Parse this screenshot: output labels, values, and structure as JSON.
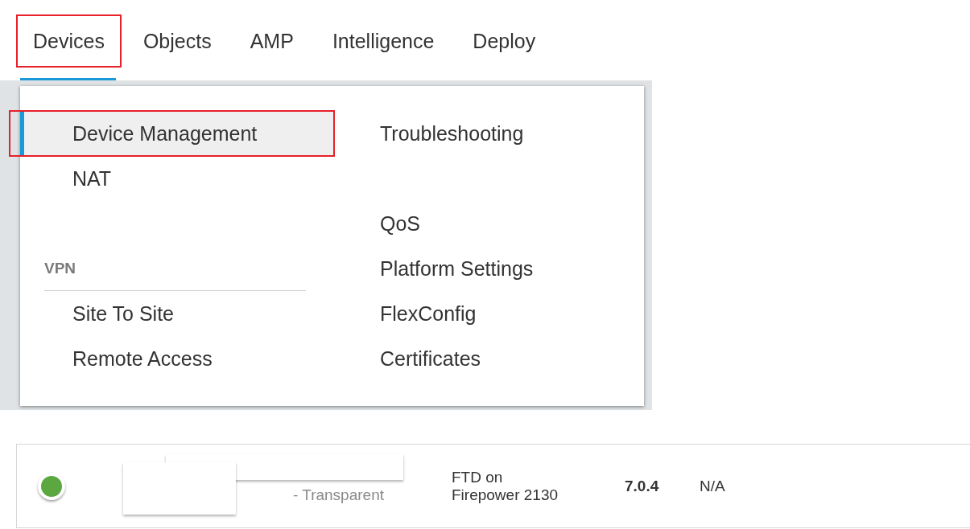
{
  "nav": {
    "tabs": [
      {
        "label": "Devices",
        "selected": true,
        "highlighted": true
      },
      {
        "label": "Objects",
        "selected": false,
        "highlighted": false
      },
      {
        "label": "AMP",
        "selected": false,
        "highlighted": false
      },
      {
        "label": "Intelligence",
        "selected": false,
        "highlighted": false
      },
      {
        "label": "Deploy",
        "selected": false,
        "highlighted": false
      }
    ]
  },
  "menu": {
    "columns": [
      [
        {
          "kind": "item",
          "label": "Device Management",
          "selected": true,
          "highlighted": true
        },
        {
          "kind": "item",
          "label": "NAT",
          "selected": false,
          "highlighted": false
        },
        {
          "kind": "gap"
        },
        {
          "kind": "header",
          "label": "VPN"
        },
        {
          "kind": "item",
          "label": "Site To Site",
          "selected": false,
          "highlighted": false
        },
        {
          "kind": "item",
          "label": "Remote Access",
          "selected": false,
          "highlighted": false
        }
      ],
      [
        {
          "kind": "item",
          "label": "Troubleshooting",
          "selected": false,
          "highlighted": false
        },
        {
          "kind": "gap"
        },
        {
          "kind": "item",
          "label": "QoS",
          "selected": false,
          "highlighted": false
        },
        {
          "kind": "item",
          "label": "Platform Settings",
          "selected": false,
          "highlighted": false
        },
        {
          "kind": "item",
          "label": "FlexConfig",
          "selected": false,
          "highlighted": false
        },
        {
          "kind": "item",
          "label": "Certificates",
          "selected": false,
          "highlighted": false
        }
      ]
    ]
  },
  "device_row": {
    "status": {
      "color": "#5aa83f"
    },
    "mode": "- Transparent",
    "model": [
      "FTD on",
      "Firepower 2130"
    ],
    "version": "7.0.4",
    "column_5": "N/A"
  }
}
